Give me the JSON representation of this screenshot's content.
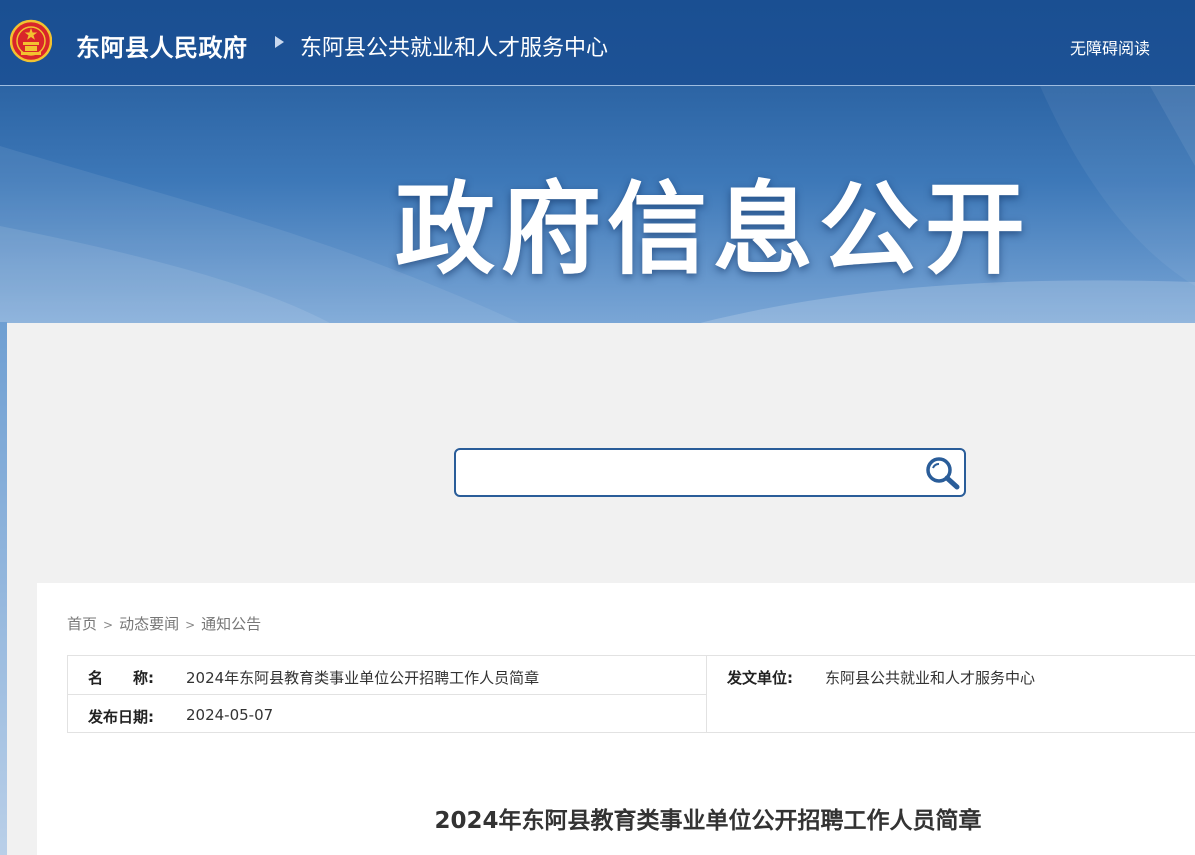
{
  "header": {
    "site_title": "东阿县人民政府",
    "sub_title": "东阿县公共就业和人才服务中心",
    "accessibility_label": "无障碍阅读"
  },
  "banner": {
    "title": "政府信息公开"
  },
  "search": {
    "value": "",
    "placeholder": ""
  },
  "breadcrumb": {
    "items": [
      "首页",
      "动态要闻",
      "通知公告"
    ],
    "separator": ">"
  },
  "meta": {
    "name_label": "名　　称:",
    "name_value": "2024年东阿县教育类事业单位公开招聘工作人员简章",
    "issuer_label": "发文单位:",
    "issuer_value": "东阿县公共就业和人才服务中心",
    "date_label": "发布日期:",
    "date_value": "2024-05-07"
  },
  "article": {
    "title": "2024年东阿县教育类事业单位公开招聘工作人员简章"
  },
  "colors": {
    "header_bg": "#1a4f92",
    "search_border": "#2a5d99",
    "page_bg": "#f1f1f1"
  }
}
